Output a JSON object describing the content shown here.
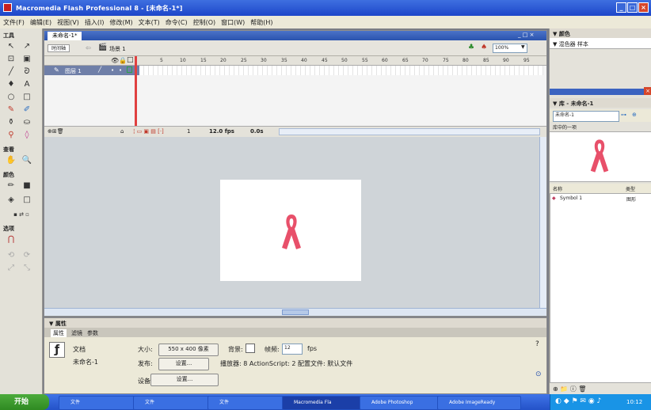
{
  "window": {
    "title": "Macromedia Flash Professional 8 - [未命名-1*]",
    "controls": [
      "_",
      "□",
      "×"
    ]
  },
  "menu": [
    "文件(F)",
    "编辑(E)",
    "视图(V)",
    "插入(I)",
    "修改(M)",
    "文本(T)",
    "命令(C)",
    "控制(O)",
    "窗口(W)",
    "帮助(H)"
  ],
  "tools": {
    "header": "工具",
    "view_header": "查看",
    "color_header": "颜色",
    "options_header": "选项"
  },
  "document": {
    "tab": "未命名-1*",
    "timeline_button": "时间轴",
    "scene": "场景 1",
    "zoom": "100%",
    "layer_name": "图层 1",
    "frame_numbers": [
      "5",
      "10",
      "15",
      "20",
      "25",
      "30",
      "35",
      "40",
      "45",
      "50",
      "55",
      "60",
      "65",
      "70",
      "75",
      "80",
      "85",
      "90",
      "95"
    ],
    "status": {
      "current_frame": "1",
      "frame_rate": "12.0 fps",
      "elapsed": "0.0s"
    }
  },
  "properties": {
    "panel_title": "▼ 属性",
    "tabs": [
      "属性",
      "滤镜",
      "参数"
    ],
    "doc_label": "文档",
    "doc_name": "未命名-1",
    "size_label": "大小:",
    "size_value": "550 x 400 像素",
    "bg_label": "背景:",
    "fps_label": "帧频:",
    "fps_value": "12",
    "fps_unit": "fps",
    "publish_label": "发布:",
    "settings_button": "设置...",
    "player_info": "播放器: 8    ActionScript: 2    配置文件: 默认文件",
    "device_label": "设备:",
    "device_button": "设置..."
  },
  "right_panels": {
    "align_header": "▼ 颜色",
    "align_tabs": "▼ 混色器 样本",
    "library_header": "▼ 库 - 未命名-1",
    "library_select": "未命名-1",
    "library_count": "库中的一项",
    "col_name": "名称",
    "col_type": "类型",
    "items": [
      {
        "name": "Symbol 1",
        "type": "图形"
      }
    ]
  },
  "taskbar": {
    "start": "开始",
    "tasks": [
      "文件",
      "文件",
      "文件",
      "Macromedia Fla",
      "Adobe Photoshop",
      "Adobe ImageReady"
    ],
    "time": "10:12"
  },
  "colors": {
    "ribbon": "#e8506a",
    "title_blue": "#2a53c8",
    "taskbar": "#2452c8"
  }
}
